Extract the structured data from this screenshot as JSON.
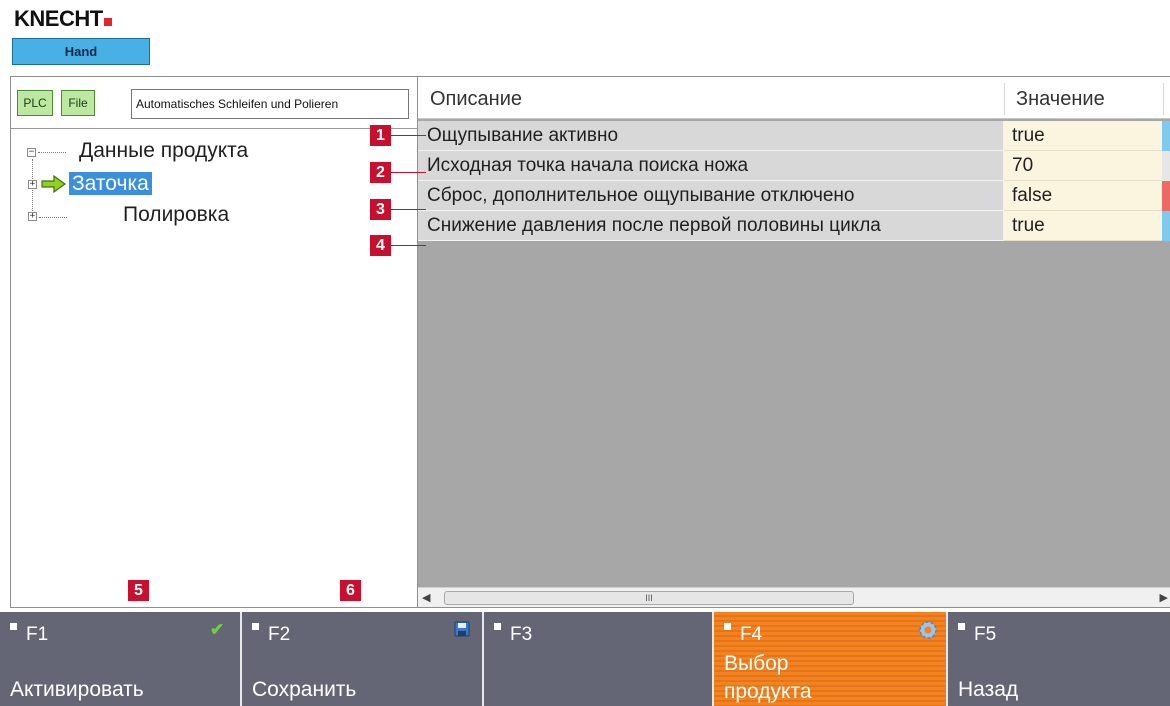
{
  "app": {
    "brand": "KNECHT",
    "mode": "Hand"
  },
  "left_panel": {
    "toolbar": {
      "plc_label": "PLC",
      "file_label": "File",
      "program_name": "Automatisches Schleifen und Polieren"
    },
    "tree": {
      "root_label": "Данные продукта",
      "children": [
        {
          "label": "Заточка",
          "selected": true
        },
        {
          "label": "Полировка",
          "selected": false
        }
      ]
    }
  },
  "grid": {
    "columns": {
      "description": "Описание",
      "value": "Значение"
    },
    "rows": [
      {
        "description": "Ощупывание активно",
        "value": "true",
        "indicator_color": "#7fc8ee"
      },
      {
        "description": "Исходная точка начала поиска ножа",
        "value": "70",
        "indicator_color": "#e6e6e6"
      },
      {
        "description": "Сброс, дополнительное ощупывание отключено",
        "value": "false",
        "indicator_color": "#ec6a63"
      },
      {
        "description": "Снижение давления после первой половины цикла",
        "value": "true",
        "indicator_color": "#7fc8ee"
      }
    ],
    "scrollbar_grip": "III"
  },
  "callouts": [
    "1",
    "2",
    "3",
    "4",
    "5",
    "6"
  ],
  "function_keys": [
    {
      "code": "F1",
      "label": "Активировать",
      "icon": "checkmark-icon",
      "active": false
    },
    {
      "code": "F2",
      "label": "Сохранить",
      "icon": "floppy-disk-icon",
      "active": false
    },
    {
      "code": "F3",
      "label": "",
      "icon": "",
      "active": false
    },
    {
      "code": "F4",
      "label_line1": "Выбор",
      "label_line2": "продукта",
      "icon": "gear-icon",
      "active": true
    },
    {
      "code": "F5",
      "label": "Назад",
      "icon": "",
      "active": false
    }
  ]
}
